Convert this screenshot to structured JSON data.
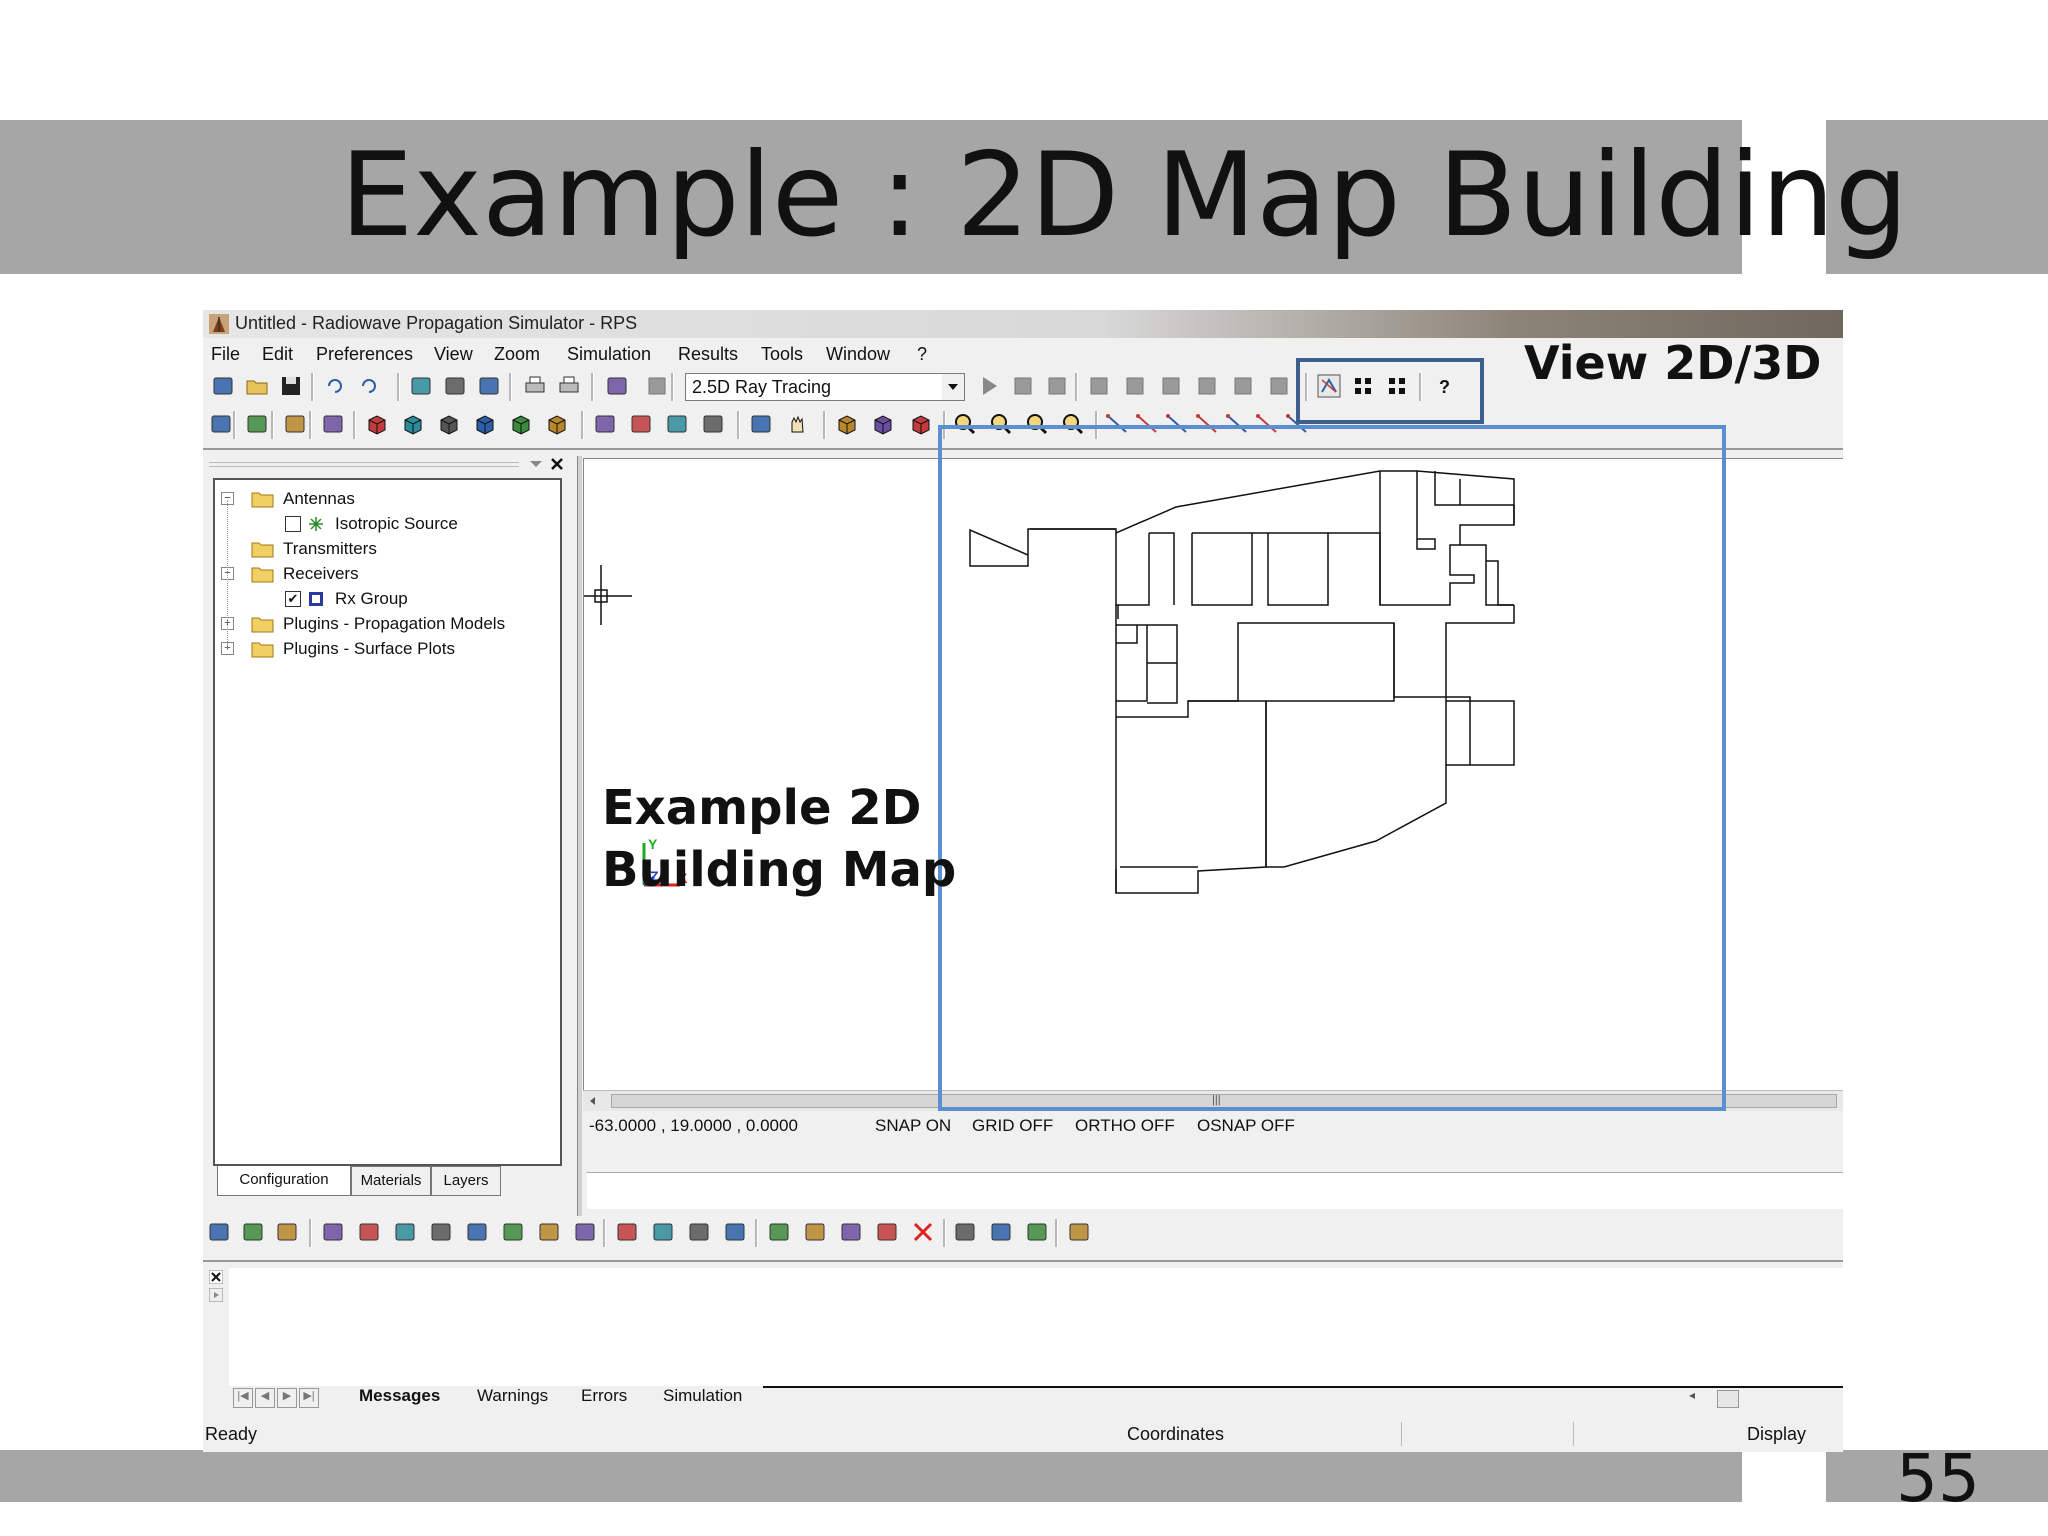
{
  "slide": {
    "title": "Example : 2D Map Building",
    "page_number": "55",
    "banner_color": "#a6a6a6"
  },
  "annotations": {
    "view_toggle": "View 2D/3D",
    "map_label_line1": "Example 2D",
    "map_label_line2": "Building Map",
    "toggle_box_color": "#3d5f8f",
    "map_box_color": "#5b8fd0"
  },
  "window": {
    "title": "Untitled - Radiowave Propagation Simulator - RPS"
  },
  "menu": [
    "File",
    "Edit",
    "Preferences",
    "View",
    "Zoom",
    "Simulation",
    "Results",
    "Tools",
    "Window",
    "?"
  ],
  "toolbar": {
    "simulation_mode": "2.5D Ray Tracing"
  },
  "tree": {
    "items": [
      {
        "label": "Antennas",
        "expand": "−",
        "kind": "folder"
      },
      {
        "label": "Isotropic Source",
        "kind": "checkbox",
        "checked": false
      },
      {
        "label": "Transmitters",
        "kind": "folder"
      },
      {
        "label": "Receivers",
        "expand": "−",
        "kind": "folder"
      },
      {
        "label": "Rx Group",
        "kind": "checkbox",
        "checked": true
      },
      {
        "label": "Plugins - Propagation Models",
        "expand": "+",
        "kind": "folder"
      },
      {
        "label": "Plugins - Surface Plots",
        "expand": "+",
        "kind": "folder"
      }
    ],
    "tabs": [
      "Configuration",
      "Materials",
      "Layers"
    ]
  },
  "status": {
    "coordinates": "-63.0000 , 19.0000 , 0.0000",
    "snap": "SNAP ON",
    "grid": "GRID OFF",
    "ortho": "ORTHO OFF",
    "osnap": "OSNAP OFF"
  },
  "axis": {
    "y": "Y",
    "z": "Z",
    "x": "X"
  },
  "messages": {
    "tabs": [
      "Messages",
      "Warnings",
      "Errors",
      "Simulation"
    ]
  },
  "statusbar": {
    "left": "Ready",
    "middle": "Coordinates",
    "right": "Display"
  },
  "icons": {
    "toolbar1": [
      "new-file-icon",
      "open-folder-icon",
      "save-icon",
      "undo-icon",
      "redo-icon",
      "cut-icon",
      "copy-icon",
      "paste-icon",
      "print-icon",
      "print-preview-icon",
      "wizard-icon",
      "stop-icon"
    ],
    "toolbar1b": [
      "run-icon",
      "stop-sim-icon",
      "pause-sim-icon",
      "result-1-icon",
      "result-2-icon",
      "result-3-icon",
      "result-4-icon",
      "result-5-icon",
      "result-6-icon",
      "view-2d3d-icon",
      "tile-grid-icon",
      "tile-grid-alt-icon",
      "help-icon"
    ],
    "toolbar2": [
      "pencil-icon",
      "transmitter-tool-icon",
      "receiver-tool-icon",
      "transform-icon",
      "cube-1-icon",
      "cube-2-icon",
      "cube-3-icon",
      "cube-4-icon",
      "cube-5-icon",
      "cube-6-icon",
      "shape-1-icon",
      "shape-2-icon",
      "shape-3-icon",
      "shape-4-icon",
      "orbit-icon",
      "pan-hand-icon",
      "solid-box-icon",
      "wire-box-icon",
      "frame-box-icon",
      "zoom-in-icon",
      "zoom-out-icon",
      "zoom-window-icon",
      "zoom-extents-icon",
      "line-1-icon",
      "line-2-icon",
      "line-3-icon",
      "line-4-icon",
      "line-5-icon",
      "line-6-icon",
      "delete-line-icon"
    ],
    "toolbar3": [
      "tool-a-icon",
      "tool-b-icon",
      "tool-c-icon",
      "tool-d-icon",
      "tool-e-icon",
      "tool-f-icon",
      "tool-g-icon",
      "tool-h-icon",
      "tool-i-icon",
      "tool-j-icon",
      "tool-k-icon",
      "import-dwg-icon",
      "tool-l-icon",
      "tool-m-icon",
      "tool-n-icon",
      "tool-o-icon",
      "tool-p-icon",
      "tool-q-icon",
      "tool-r-icon",
      "delete-icon",
      "tool-s-icon",
      "tool-t-icon",
      "tool-u-icon",
      "tool-v-icon"
    ]
  }
}
